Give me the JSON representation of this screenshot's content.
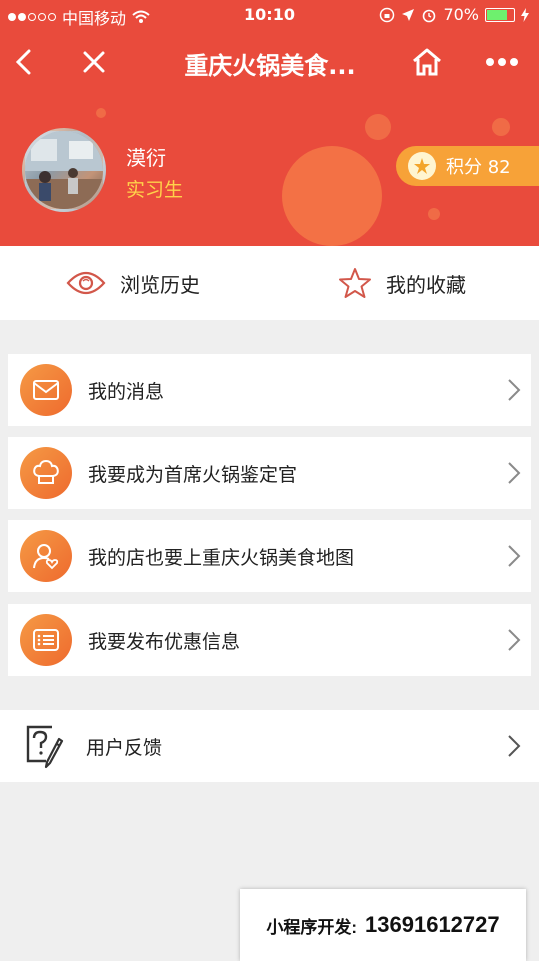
{
  "status_bar": {
    "carrier": "中国移动",
    "time": "10:10",
    "battery": "70%",
    "battery_level": 0.7
  },
  "navbar": {
    "title": "重庆火锅美食...",
    "icons": [
      "back-icon",
      "close-icon",
      "home-icon",
      "more-icon"
    ]
  },
  "profile": {
    "name": "漠衍",
    "role": "实习生",
    "points_label": "积分 82"
  },
  "quick_links": [
    {
      "label": "浏览历史",
      "icon": "eye-icon"
    },
    {
      "label": "我的收藏",
      "icon": "star-icon"
    }
  ],
  "menu": [
    {
      "label": "我的消息",
      "icon": "envelope-icon"
    },
    {
      "label": "我要成为首席火锅鉴定官",
      "icon": "chef-hat-icon"
    },
    {
      "label": "我的店也要上重庆火锅美食地图",
      "icon": "user-heart-icon"
    },
    {
      "label": "我要发布优惠信息",
      "icon": "list-card-icon"
    }
  ],
  "feedback": {
    "label": "用户反馈",
    "icon": "question-edit-icon"
  },
  "ad_banner": {
    "prefix": "小程序开发:",
    "phone": "13691612727"
  },
  "colors": {
    "brand_red": "#e94b3c",
    "role_yellow": "#ffd24a",
    "points_orange": "#f7a238",
    "icon_orange": "#ee6a2e"
  }
}
